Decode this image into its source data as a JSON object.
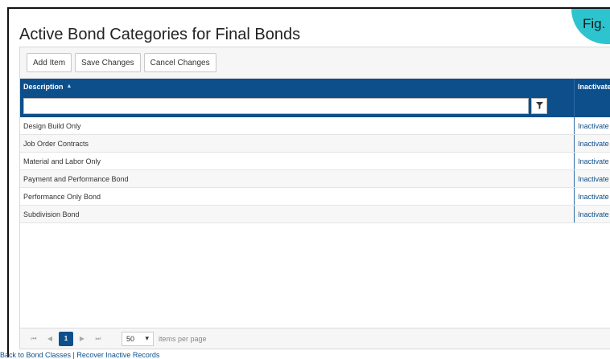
{
  "badge": "Fig.",
  "title": "Active Bond Categories for Final Bonds",
  "toolbar": {
    "add_label": "Add Item",
    "save_label": "Save Changes",
    "cancel_label": "Cancel Changes"
  },
  "columns": {
    "description": "Description",
    "inactivate": "Inactivate"
  },
  "filter": {
    "value": "",
    "icon": "filter-icon"
  },
  "rows": [
    {
      "description": "Design Build Only",
      "action": "Inactivate"
    },
    {
      "description": "Job Order Contracts",
      "action": "Inactivate"
    },
    {
      "description": "Material and Labor Only",
      "action": "Inactivate"
    },
    {
      "description": "Payment and Performance Bond",
      "action": "Inactivate"
    },
    {
      "description": "Performance Only Bond",
      "action": "Inactivate"
    },
    {
      "description": "Subdivision Bond",
      "action": "Inactivate"
    }
  ],
  "pager": {
    "first": "⏮",
    "prev": "◀",
    "current_page": "1",
    "next": "▶",
    "last": "⏭",
    "page_size": "50",
    "items_per_page": "items per page"
  },
  "footer": {
    "back_link": "Back to Bond Classes",
    "separator": " | ",
    "recover_link": "Recover Inactive Records"
  },
  "colors": {
    "header_bg": "#0d4f8a",
    "badge_bg": "#2ec4cf"
  }
}
